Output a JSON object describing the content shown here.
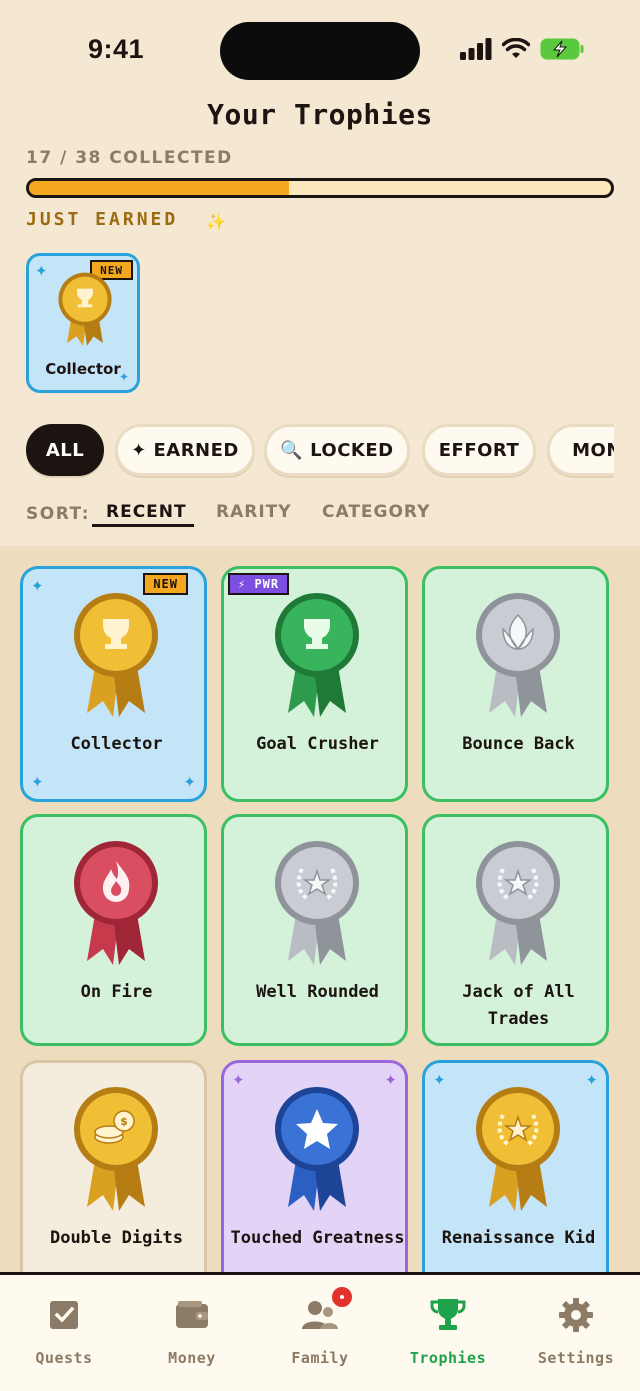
{
  "status": {
    "time": "9:41"
  },
  "header": {
    "title": "Your Trophies",
    "collected_text": "17 / 38 COLLECTED",
    "progress_fraction": 0.447
  },
  "just_earned": {
    "heading": "JUST EARNED",
    "sparkle": "✨",
    "items": [
      {
        "name": "Collector",
        "badge": "NEW"
      }
    ]
  },
  "filters": [
    {
      "label": "ALL",
      "active": true
    },
    {
      "label": "✦ EARNED",
      "active": false
    },
    {
      "label": "🔍 LOCKED",
      "active": false
    },
    {
      "label": "EFFORT",
      "active": false
    },
    {
      "label": "MON",
      "active": false
    }
  ],
  "sort": {
    "label": "SORT:",
    "options": [
      "RECENT",
      "RARITY",
      "CATEGORY"
    ],
    "active": "RECENT"
  },
  "trophies": [
    {
      "name": "Collector",
      "style": "blue",
      "medal": "gold",
      "icon": "trophy-icon",
      "badge": "NEW"
    },
    {
      "name": "Goal Crusher",
      "style": "green",
      "medal": "green",
      "icon": "trophy-icon",
      "badge": "⚡ PWR"
    },
    {
      "name": "Bounce Back",
      "style": "green",
      "medal": "silver",
      "icon": "leaf-icon",
      "badge": ""
    },
    {
      "name": "On Fire",
      "style": "green",
      "medal": "red",
      "icon": "flame-icon",
      "badge": ""
    },
    {
      "name": "Well Rounded",
      "style": "green",
      "medal": "silver",
      "icon": "laurel-star-icon",
      "badge": ""
    },
    {
      "name": "Jack of All Trades",
      "style": "green",
      "medal": "silver",
      "icon": "laurel-star-icon",
      "badge": ""
    },
    {
      "name": "Double Digits",
      "style": "plain",
      "medal": "gold",
      "icon": "coins-icon",
      "badge": ""
    },
    {
      "name": "Touched Greatness",
      "style": "purple",
      "medal": "blue",
      "icon": "star-icon",
      "badge": ""
    },
    {
      "name": "Renaissance Kid",
      "style": "blue",
      "medal": "gold",
      "icon": "laurel-star-icon",
      "badge": ""
    }
  ],
  "tabs": [
    {
      "label": "Quests",
      "icon": "checkbox-icon",
      "active": false
    },
    {
      "label": "Money",
      "icon": "wallet-icon",
      "active": false
    },
    {
      "label": "Family",
      "icon": "family-icon",
      "active": false
    },
    {
      "label": "Trophies",
      "icon": "trophy-icon",
      "active": true
    },
    {
      "label": "Settings",
      "icon": "gear-icon",
      "active": false
    }
  ],
  "colors": {
    "background": "#f5e8d3",
    "progress_fill": "#f4a81f",
    "earned_green": "#3bbf62",
    "rare_blue": "#29a1da",
    "epic_purple": "#9a66d9",
    "active_tab": "#1ea34a"
  }
}
